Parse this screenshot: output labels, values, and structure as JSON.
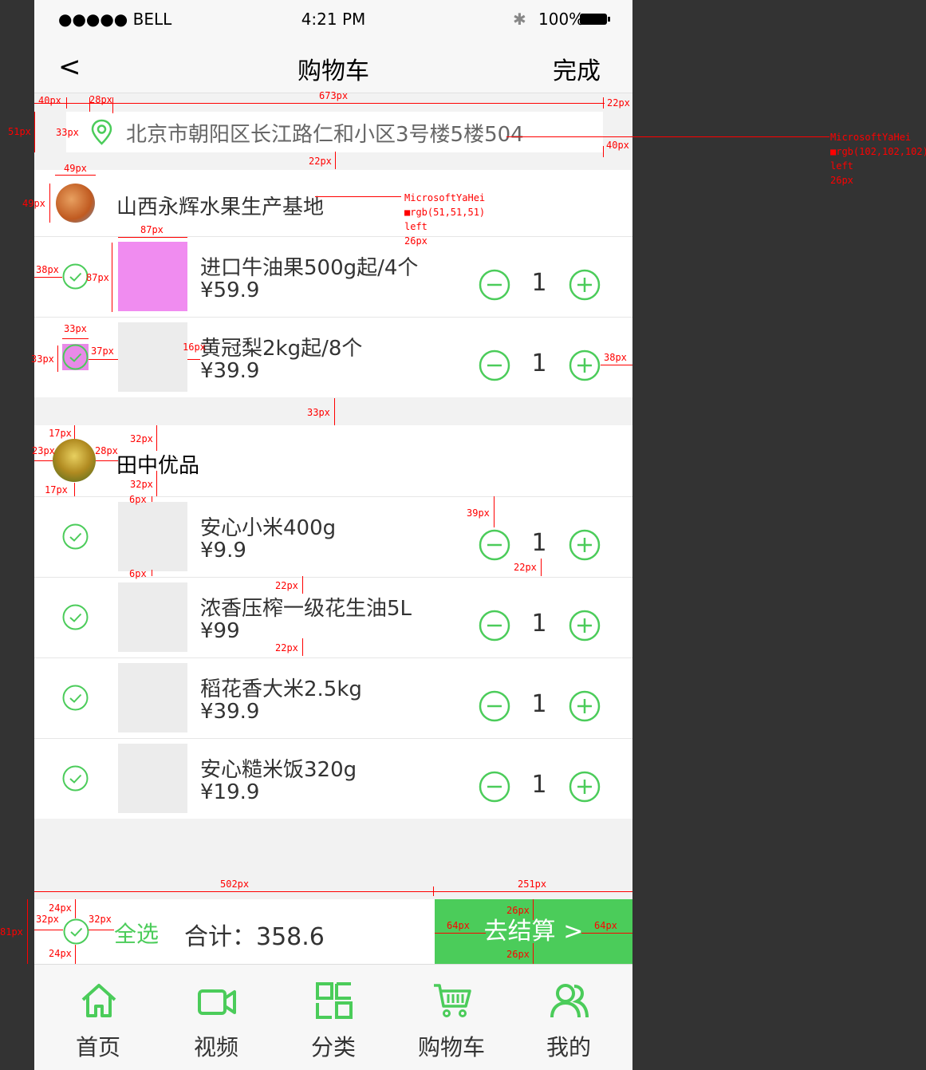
{
  "status": {
    "carrier": "●●●●● BELL",
    "time": "4:21 PM",
    "battery": "100%"
  },
  "nav": {
    "back": "<",
    "title": "购物车",
    "done": "完成"
  },
  "address": {
    "text": "北京市朝阳区长江路仁和小区3号楼5楼504"
  },
  "shops": [
    {
      "name": "山西永辉水果生产基地",
      "items": [
        {
          "name": "进口牛油果500g起/4个",
          "price": "¥59.9",
          "qty": "1"
        },
        {
          "name": "黄冠梨2kg起/8个",
          "price": "¥39.9",
          "qty": "1"
        }
      ]
    },
    {
      "name": "田中优品",
      "items": [
        {
          "name": "安心小米400g",
          "price": "¥9.9",
          "qty": "1"
        },
        {
          "name": "浓香压榨一级花生油5L",
          "price": "¥99",
          "qty": "1"
        },
        {
          "name": "稻花香大米2.5kg",
          "price": "¥39.9",
          "qty": "1"
        },
        {
          "name": "安心糙米饭320g",
          "price": "¥19.9",
          "qty": "1"
        }
      ]
    }
  ],
  "checkout": {
    "select_all": "全选",
    "total": "合计：358.6",
    "pay": "去结算 >"
  },
  "tabs": [
    {
      "label": "首页",
      "icon": "home-icon"
    },
    {
      "label": "视频",
      "icon": "video-icon"
    },
    {
      "label": "分类",
      "icon": "category-icon"
    },
    {
      "label": "购物车",
      "icon": "cart-icon"
    },
    {
      "label": "我的",
      "icon": "user-icon"
    }
  ],
  "annotations": {
    "a40": "40px",
    "a28": "28px",
    "a673": "673px",
    "a22r": "22px",
    "a51": "51px",
    "a33": "33px",
    "a40r": "40px",
    "a22": "22px",
    "a49w": "49px",
    "a49h": "49px",
    "a87": "87px",
    "a38": "38px",
    "a87h": "87px",
    "a33w": "33px",
    "a33h": "33px",
    "a37": "37px",
    "a16": "16px",
    "a38r": "38px",
    "a33g": "33px",
    "a17t": "17px",
    "a23": "23px",
    "a28b": "28px",
    "a32t": "32px",
    "a32b": "32px",
    "a17b": "17px",
    "a6a": "6px",
    "a6b": "6px",
    "a39": "39px",
    "a22q": "22px",
    "a22n1": "22px",
    "a22n2": "22px",
    "a502": "502px",
    "a251": "251px",
    "a81": "81px",
    "a24t": "24px",
    "a32l": "32px",
    "a32r": "32px",
    "a24b": "24px",
    "a64l": "64px",
    "a64r": "64px",
    "a26t": "26px",
    "a26b": "26px",
    "fontA": [
      "MicrosoftYaHei",
      "■rgb(102,102,102)",
      "left",
      "26px"
    ],
    "fontB": [
      "MicrosoftYaHei",
      "■rgb(51,51,51)",
      "left",
      "26px"
    ]
  },
  "colors": {
    "accent": "#4bcc5a",
    "text": "#333333",
    "address": "#666666",
    "annotation": "#ff0000"
  }
}
